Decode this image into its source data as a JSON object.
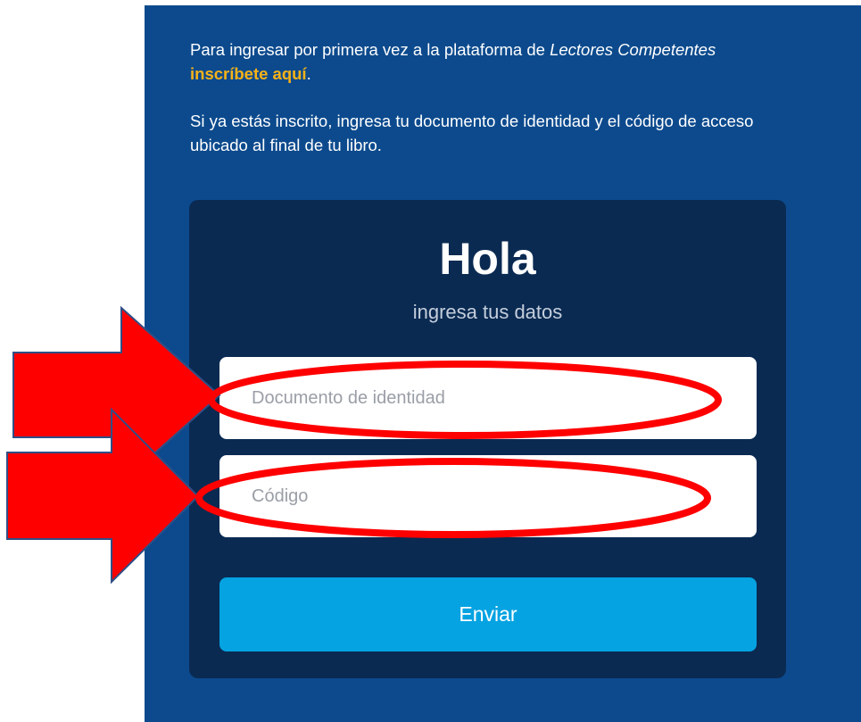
{
  "intro": {
    "line1_prefix": "Para ingresar por primera vez a la plataforma de ",
    "line1_emphasis": "Lectores Competentes",
    "line1_link": "inscríbete aquí",
    "line1_suffix": ".",
    "line2": "Si ya estás inscrito, ingresa tu documento de identidad y el código de acceso ubicado al final de tu libro."
  },
  "login_card": {
    "title": "Hola",
    "subtitle": "ingresa tus datos",
    "document_field": {
      "placeholder": "Documento de identidad",
      "value": ""
    },
    "code_field": {
      "placeholder": "Código",
      "value": ""
    },
    "submit_label": "Enviar"
  },
  "annotations": {
    "arrow_icon": "right-arrow-icon",
    "arrow_color": "#ff0000",
    "ellipse_color": "#ff0000"
  },
  "colors": {
    "page_background": "#0c4a8d",
    "card_background": "#0a2a52",
    "link_highlight": "#f7b218",
    "button_background": "#05a3e2"
  }
}
